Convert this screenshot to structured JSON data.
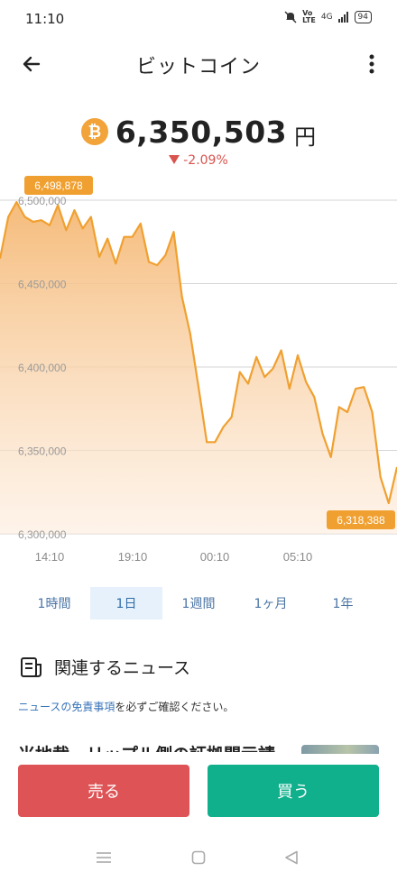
{
  "status_bar": {
    "time": "11:10",
    "network": "4G",
    "battery": "94"
  },
  "header": {
    "title": "ビットコイン",
    "back_icon": "arrow-left-icon",
    "menu_icon": "more-vertical-icon"
  },
  "price": {
    "coin_icon": "bitcoin-icon",
    "coin_symbol": "₿",
    "value": "6,350,503",
    "unit": "円",
    "change": "-2.09%",
    "change_direction": "down"
  },
  "chart_data": {
    "type": "area",
    "color": "#f0a030",
    "y_ticks": [
      "6,500,000",
      "6,450,000",
      "6,400,000",
      "6,350,000",
      "6,300,000"
    ],
    "y_tick_values": [
      6500000,
      6450000,
      6400000,
      6350000,
      6300000
    ],
    "ylim": [
      6300000,
      6500000
    ],
    "x_ticks": [
      "14:10",
      "19:10",
      "00:10",
      "05:10"
    ],
    "high_label": "6,498,878",
    "low_label": "6,318,388",
    "values": [
      6465000,
      6490000,
      6498878,
      6490000,
      6487000,
      6488000,
      6485000,
      6497000,
      6482000,
      6494000,
      6483000,
      6490000,
      6466000,
      6477000,
      6462000,
      6478000,
      6478000,
      6486000,
      6463000,
      6461000,
      6467000,
      6481000,
      6442000,
      6420000,
      6388000,
      6355000,
      6355000,
      6364000,
      6370000,
      6397000,
      6390000,
      6406000,
      6394000,
      6399000,
      6410000,
      6387000,
      6407000,
      6391000,
      6382000,
      6360000,
      6346000,
      6376000,
      6373000,
      6387000,
      6388000,
      6373000,
      6334000,
      6318388,
      6340000
    ]
  },
  "range_tabs": [
    {
      "label": "1時間",
      "active": false
    },
    {
      "label": "1日",
      "active": true
    },
    {
      "label": "1週間",
      "active": false
    },
    {
      "label": "1ヶ月",
      "active": false
    },
    {
      "label": "1年",
      "active": false
    }
  ],
  "news": {
    "icon": "newspaper-icon",
    "title": "関連するニュース",
    "disclaimer_link": "ニュースの免責事項",
    "disclaimer_rest": "を必ずご確認ください。",
    "preview_headline": "米地裁、リップル側の証拠開示請求"
  },
  "actions": {
    "sell_label": "売る",
    "sell_color": "#de5355",
    "buy_label": "買う",
    "buy_color": "#10b08c"
  },
  "nav": {
    "menu_icon": "menu-icon",
    "home_icon": "square-icon",
    "back_icon": "triangle-back-icon"
  }
}
